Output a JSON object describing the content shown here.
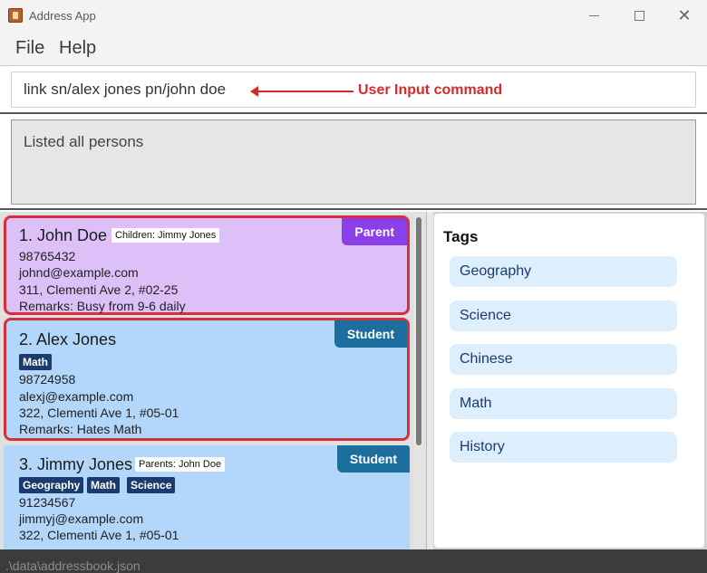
{
  "window": {
    "title": "Address App"
  },
  "menu": {
    "file": "File",
    "help": "Help"
  },
  "command": {
    "value": "link sn/alex jones pn/john doe"
  },
  "annotation": {
    "label": "User  Input command",
    "color": "#d42a2a"
  },
  "result": {
    "text": "Listed all persons"
  },
  "persons": [
    {
      "name": "1. John Doe",
      "relation": "Children: Jimmy Jones",
      "role": "Parent",
      "tags": [],
      "phone": "98765432",
      "email": "johnd@example.com",
      "address": "311, Clementi Ave 2, #02-25",
      "remarks": "Remarks: Busy from 9-6 daily",
      "selected": true
    },
    {
      "name": "2. Alex Jones",
      "relation": "",
      "role": "Student",
      "tags": [
        "Math"
      ],
      "phone": "98724958",
      "email": "alexj@example.com",
      "address": "322, Clementi Ave 1, #05-01",
      "remarks": "Remarks: Hates Math",
      "selected": true
    },
    {
      "name": "3. Jimmy Jones",
      "relation": "Parents: John Doe",
      "role": "Student",
      "tags": [
        "Geography",
        "Math",
        "Science"
      ],
      "phone": "91234567",
      "email": "jimmyj@example.com",
      "address": "322, Clementi Ave 1, #05-01",
      "remarks": "",
      "selected": false
    }
  ],
  "tags_panel": {
    "title": "Tags",
    "items": [
      "Geography",
      "Science",
      "Chinese",
      "Math",
      "History"
    ]
  },
  "status": {
    "path": ".\\data\\addressbook.json"
  },
  "colors": {
    "parent_card": "#dcc0f7",
    "student_card": "#b3d6fb",
    "parent_badge": "#8a3fe8",
    "student_badge": "#1c6e9f",
    "highlight_border": "#d4303d",
    "tag_chip": "#1b3b6f",
    "tag_pill": "#ddeefd"
  }
}
